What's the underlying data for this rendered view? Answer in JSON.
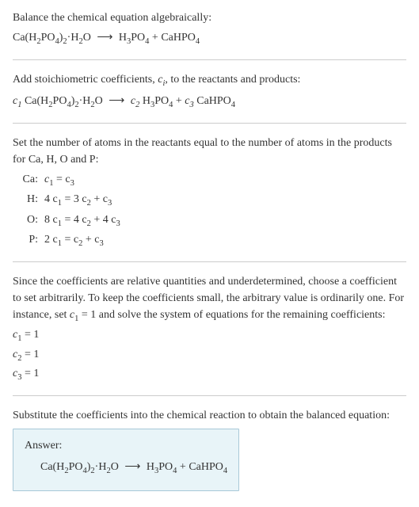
{
  "chart_data": {
    "type": "table",
    "title": "Balance the chemical equation algebraically",
    "reaction": {
      "reactants": [
        "Ca(H2PO4)2·H2O"
      ],
      "products": [
        "H3PO4",
        "CaHPO4"
      ]
    },
    "coefficients_symbolic": {
      "c1": "Ca(H2PO4)2·H2O",
      "c2": "H3PO4",
      "c3": "CaHPO4"
    },
    "atom_balance_equations": [
      {
        "element": "Ca",
        "equation": "c1 = c3"
      },
      {
        "element": "H",
        "equation": "4 c1 = 3 c2 + c3"
      },
      {
        "element": "O",
        "equation": "8 c1 = 4 c2 + 4 c3"
      },
      {
        "element": "P",
        "equation": "2 c1 = c2 + c3"
      }
    ],
    "solved_coefficients": {
      "c1": 1,
      "c2": 1,
      "c3": 1
    },
    "balanced_equation": "Ca(H2PO4)2·H2O ⟶ H3PO4 + CaHPO4"
  },
  "text": {
    "intro": "Balance the chemical equation algebraically:",
    "step2_line1": "Add stoichiometric coefficients, ",
    "step2_ci": "c",
    "step2_ci_sub": "i",
    "step2_line1_end": ", to the reactants and products:",
    "step3_intro": "Set the number of atoms in the reactants equal to the number of atoms in the products for Ca, H, O and P:",
    "atoms": {
      "Ca_label": "Ca:",
      "Ca_eq_l": "c",
      "Ca_eq": " = c",
      "H_label": "H:",
      "H_eq_pre": "4 c",
      "H_eq_mid": " = 3 c",
      "H_eq_end": " + c",
      "O_label": "O:",
      "O_eq_pre": "8 c",
      "O_eq_mid": " = 4 c",
      "O_eq_end": " + 4 c",
      "P_label": "P:",
      "P_eq_pre": "2 c",
      "P_eq_mid": " = c",
      "P_eq_end": " + c"
    },
    "sub1": "1",
    "sub2": "2",
    "sub3": "3",
    "sub4": "4",
    "step4_intro_a": "Since the coefficients are relative quantities and underdetermined, choose a coefficient to set arbitrarily. To keep the coefficients small, the arbitrary value is ordinarily one. For instance, set ",
    "step4_intro_b": " = 1 and solve the system of equations for the remaining coefficients:",
    "c1_line_a": "c",
    "c1_line_b": " = 1",
    "c2_line_b": " = 1",
    "c3_line_b": " = 1",
    "step5_intro": "Substitute the coefficients into the chemical reaction to obtain the balanced equation:",
    "answer_label": "Answer:",
    "formula": {
      "CaH2PO4": "Ca(H",
      "PO4": "PO",
      "paren2": ")",
      "dot": "·H",
      "O": "O",
      "arrow": "⟶",
      "H3PO4_H": "H",
      "plus": " + ",
      "CaHPO4": "CaHPO"
    }
  }
}
